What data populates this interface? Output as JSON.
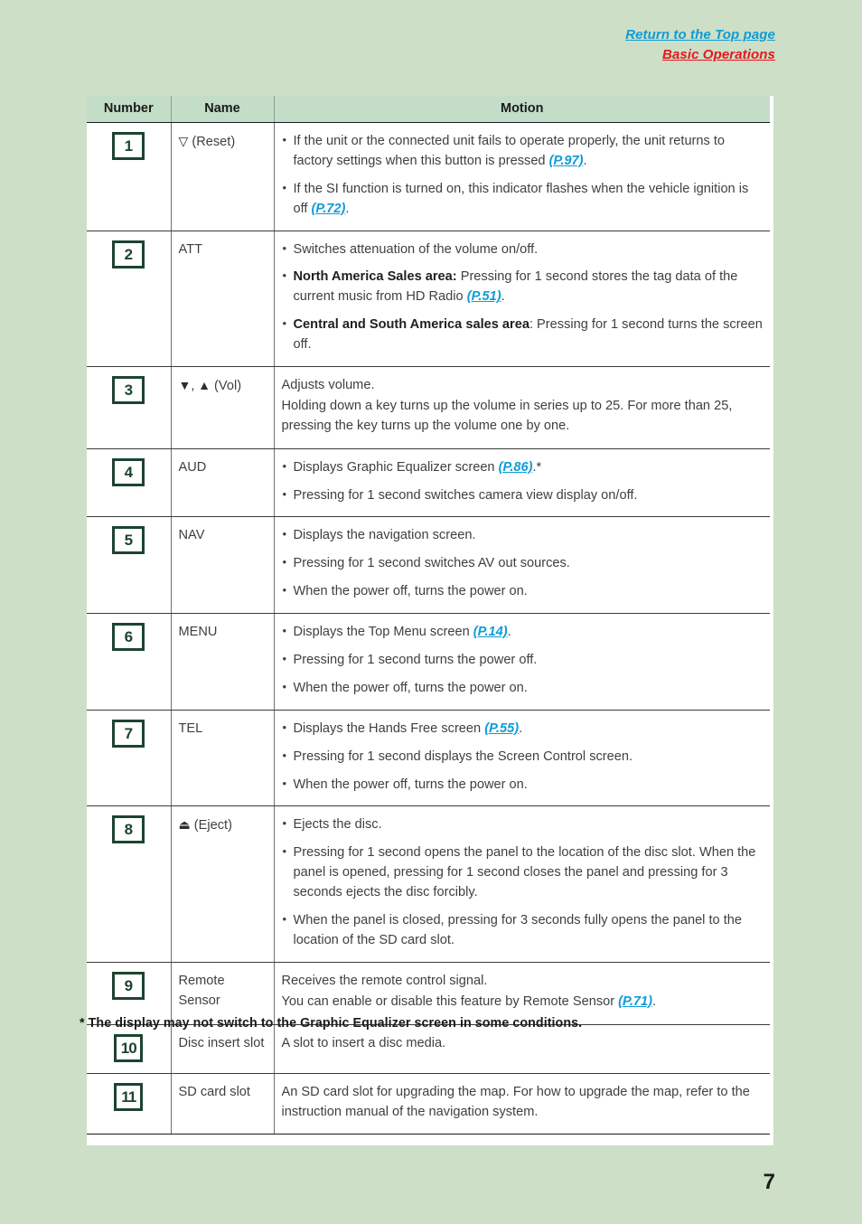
{
  "header": {
    "link_top": "Return to the Top page",
    "link_section": "Basic Operations"
  },
  "table": {
    "columns": {
      "number": "Number",
      "name": "Name",
      "motion": "Motion"
    },
    "rows": [
      {
        "number": "1",
        "name_symbol": "▽",
        "name_text": " (Reset)",
        "motion": [
          {
            "bullet": true,
            "parts": [
              {
                "t": "text",
                "v": "If the unit or the connected unit fails to operate properly, the unit returns to factory settings when this button is pressed "
              },
              {
                "t": "ref",
                "v": "(P.97)"
              },
              {
                "t": "text",
                "v": "."
              }
            ]
          },
          {
            "bullet": true,
            "parts": [
              {
                "t": "text",
                "v": "If the SI function is turned on, this indicator flashes when the vehicle ignition is off "
              },
              {
                "t": "ref",
                "v": "(P.72)"
              },
              {
                "t": "text",
                "v": "."
              }
            ]
          }
        ]
      },
      {
        "number": "2",
        "name_symbol": "",
        "name_text": "ATT",
        "motion": [
          {
            "bullet": true,
            "parts": [
              {
                "t": "text",
                "v": "Switches attenuation of the volume on/off."
              }
            ]
          },
          {
            "bullet": true,
            "parts": [
              {
                "t": "bold",
                "v": "North America Sales area:"
              },
              {
                "t": "text",
                "v": " Pressing for 1 second stores the tag data of the current music from HD Radio "
              },
              {
                "t": "ref",
                "v": "(P.51)"
              },
              {
                "t": "text",
                "v": "."
              }
            ]
          },
          {
            "bullet": true,
            "parts": [
              {
                "t": "bold",
                "v": "Central and South America sales area"
              },
              {
                "t": "text",
                "v": ": Pressing for 1 second turns the screen off."
              }
            ]
          }
        ]
      },
      {
        "number": "3",
        "name_symbol": "▼, ▲",
        "name_text": " (Vol)",
        "motion": [
          {
            "bullet": false,
            "parts": [
              {
                "t": "text",
                "v": "Adjusts volume."
              }
            ]
          },
          {
            "bullet": false,
            "parts": [
              {
                "t": "text",
                "v": "Holding down a key turns up the volume in series up to 25. For more than 25, pressing the key turns up the volume one by one."
              }
            ]
          }
        ]
      },
      {
        "number": "4",
        "name_symbol": "",
        "name_text": "AUD",
        "motion": [
          {
            "bullet": true,
            "parts": [
              {
                "t": "text",
                "v": "Displays Graphic Equalizer screen "
              },
              {
                "t": "ref",
                "v": "(P.86)"
              },
              {
                "t": "text",
                "v": ".*"
              }
            ]
          },
          {
            "bullet": true,
            "parts": [
              {
                "t": "text",
                "v": "Pressing for 1 second switches camera view display on/off."
              }
            ]
          }
        ]
      },
      {
        "number": "5",
        "name_symbol": "",
        "name_text": "NAV",
        "motion": [
          {
            "bullet": true,
            "parts": [
              {
                "t": "text",
                "v": "Displays the navigation screen."
              }
            ]
          },
          {
            "bullet": true,
            "parts": [
              {
                "t": "text",
                "v": "Pressing for 1 second switches AV out sources."
              }
            ]
          },
          {
            "bullet": true,
            "parts": [
              {
                "t": "text",
                "v": "When the power off, turns the power on."
              }
            ]
          }
        ]
      },
      {
        "number": "6",
        "name_symbol": "",
        "name_text": "MENU",
        "motion": [
          {
            "bullet": true,
            "parts": [
              {
                "t": "text",
                "v": "Displays the Top Menu screen "
              },
              {
                "t": "ref",
                "v": "(P.14)"
              },
              {
                "t": "text",
                "v": "."
              }
            ]
          },
          {
            "bullet": true,
            "parts": [
              {
                "t": "text",
                "v": "Pressing for 1 second turns the power off."
              }
            ]
          },
          {
            "bullet": true,
            "parts": [
              {
                "t": "text",
                "v": "When the power off, turns the power on."
              }
            ]
          }
        ]
      },
      {
        "number": "7",
        "name_symbol": "",
        "name_text": "TEL",
        "motion": [
          {
            "bullet": true,
            "parts": [
              {
                "t": "text",
                "v": "Displays the Hands Free screen "
              },
              {
                "t": "ref",
                "v": "(P.55)"
              },
              {
                "t": "text",
                "v": "."
              }
            ]
          },
          {
            "bullet": true,
            "parts": [
              {
                "t": "text",
                "v": "Pressing for 1 second displays the Screen Control screen."
              }
            ]
          },
          {
            "bullet": true,
            "parts": [
              {
                "t": "text",
                "v": "When the power off, turns the power on."
              }
            ]
          }
        ]
      },
      {
        "number": "8",
        "name_symbol": "⏏",
        "name_text": " (Eject)",
        "motion": [
          {
            "bullet": true,
            "parts": [
              {
                "t": "text",
                "v": "Ejects the disc."
              }
            ]
          },
          {
            "bullet": true,
            "parts": [
              {
                "t": "text",
                "v": "Pressing for 1 second opens the panel to the location of the disc slot. When the panel is opened, pressing for 1 second closes the panel and pressing for 3 seconds ejects the disc forcibly."
              }
            ]
          },
          {
            "bullet": true,
            "parts": [
              {
                "t": "text",
                "v": "When the panel is closed, pressing for 3 seconds fully opens the panel to the location of the SD card slot."
              }
            ]
          }
        ]
      },
      {
        "number": "9",
        "name_symbol": "",
        "name_text": "Remote Sensor",
        "motion": [
          {
            "bullet": false,
            "parts": [
              {
                "t": "text",
                "v": "Receives the remote control signal."
              }
            ]
          },
          {
            "bullet": false,
            "parts": [
              {
                "t": "text",
                "v": "You can enable or disable this feature by Remote Sensor "
              },
              {
                "t": "ref",
                "v": "(P.71)"
              },
              {
                "t": "text",
                "v": "."
              }
            ]
          }
        ]
      },
      {
        "number": "10",
        "name_symbol": "",
        "name_text": "Disc insert slot",
        "motion": [
          {
            "bullet": false,
            "parts": [
              {
                "t": "text",
                "v": "A slot to insert a disc media."
              }
            ]
          }
        ]
      },
      {
        "number": "11",
        "name_symbol": "",
        "name_text": "SD card slot",
        "motion": [
          {
            "bullet": false,
            "parts": [
              {
                "t": "text",
                "v": "An SD card slot for upgrading the map. For how to upgrade the map, refer to the instruction manual of the navigation system."
              }
            ]
          }
        ]
      }
    ]
  },
  "footnote": "* The display may not switch to the Graphic Equalizer screen in some conditions.",
  "page_number": "7",
  "colors": {
    "page_background": "#cddfc6",
    "header_cell": "#c3ddc8",
    "badge": "#1d4430",
    "link_blue": "#0d9cd8",
    "link_red": "#e8161f"
  }
}
